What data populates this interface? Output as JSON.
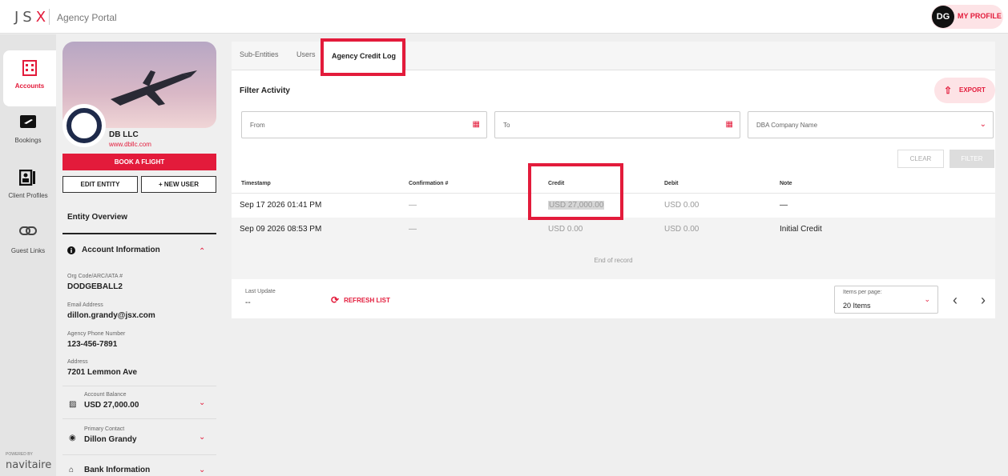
{
  "header": {
    "logo": "JSX",
    "portal_title": "Agency Portal",
    "avatar_initials": "DG",
    "profile_label": "MY PROFILE"
  },
  "rail": {
    "items": [
      {
        "label": "Accounts",
        "icon": "building-icon",
        "active": true
      },
      {
        "label": "Bookings",
        "icon": "plane-ticket-icon",
        "active": false
      },
      {
        "label": "Client Profiles",
        "icon": "id-card-icon",
        "active": false
      },
      {
        "label": "Guest Links",
        "icon": "link-icon",
        "active": false
      }
    ],
    "powered_by": "POWERED BY",
    "footer_brand": "navitaire"
  },
  "entity": {
    "name": "DB LLC",
    "url": "www.dbllc.com",
    "book_button": "BOOK A FLIGHT",
    "edit_button": "EDIT ENTITY",
    "new_user_button": "+ NEW USER",
    "overview_title": "Entity Overview",
    "account_info_title": "Account Information",
    "fields": [
      {
        "label": "Org Code/ARC/IATA #",
        "value": "DODGEBALL2"
      },
      {
        "label": "Email Address",
        "value": "dillon.grandy@jsx.com"
      },
      {
        "label": "Agency Phone Number",
        "value": "123-456-7891"
      },
      {
        "label": "Address",
        "value": "7201 Lemmon Ave"
      }
    ],
    "balance": {
      "label": "Account Balance",
      "value": "USD 27,000.00"
    },
    "contact": {
      "label": "Primary Contact",
      "value": "Dillon Grandy"
    },
    "bank_title": "Bank Information"
  },
  "tabs": [
    "Sub-Entities",
    "Users",
    "Agency Credit Log"
  ],
  "filter": {
    "title": "Filter Activity",
    "export_label": "EXPORT",
    "from_placeholder": "From",
    "to_placeholder": "To",
    "company_placeholder": "DBA Company Name",
    "clear_label": "CLEAR",
    "filter_label": "FILTER"
  },
  "table": {
    "columns": [
      "Timestamp",
      "Confirmation #",
      "Credit",
      "Debit",
      "Note"
    ],
    "rows": [
      {
        "timestamp": "Sep 17 2026 01:41 PM",
        "confirmation": "—",
        "credit": "USD 27,000.00",
        "debit": "USD 0.00",
        "note": "—"
      },
      {
        "timestamp": "Sep 09 2026 08:53 PM",
        "confirmation": "—",
        "credit": "USD 0.00",
        "debit": "USD 0.00",
        "note": "Initial Credit"
      }
    ],
    "end_text": "End of record"
  },
  "footer": {
    "last_update_label": "Last Update",
    "last_update_value": "--",
    "refresh_label": "REFRESH LIST",
    "items_per_page_label": "Items per page:",
    "items_per_page_value": "20 Items"
  },
  "colors": {
    "accent": "#e31b3b",
    "rail_bg": "#e4e4e4",
    "page_bg": "#efefef"
  }
}
